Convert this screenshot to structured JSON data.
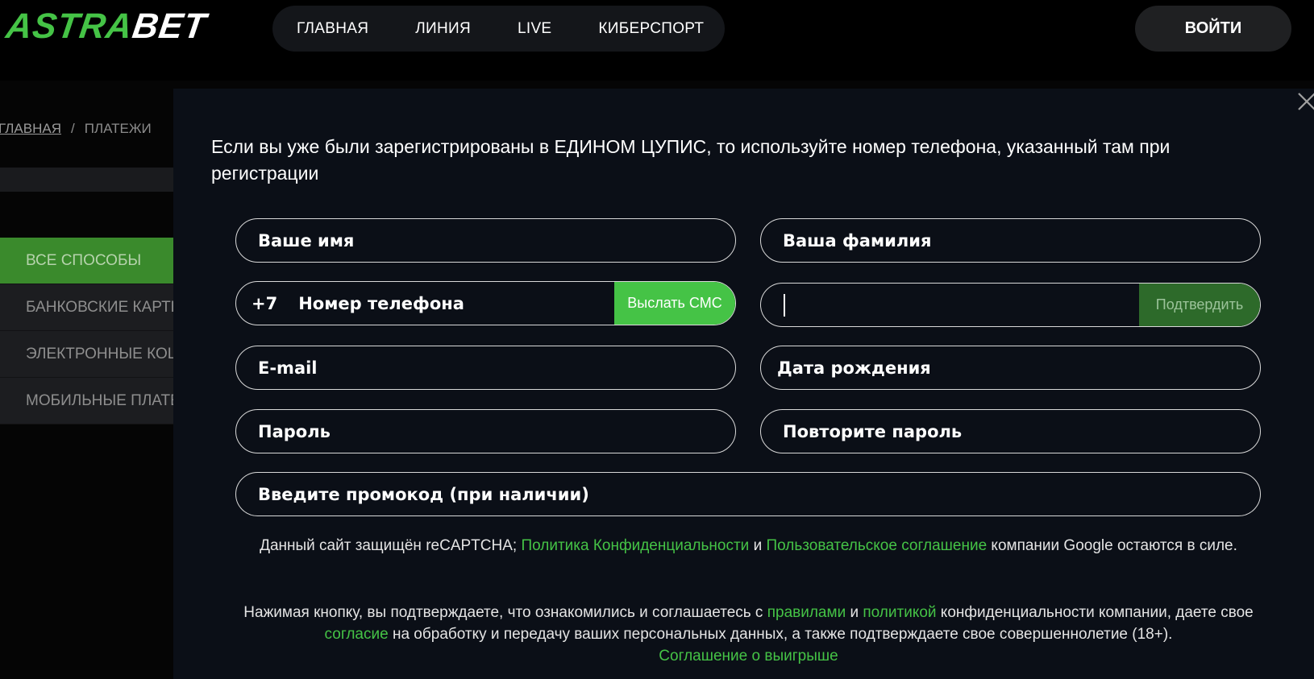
{
  "header": {
    "logo_part1": "ASTRA",
    "logo_part2": "BET",
    "nav": [
      "ГЛАВНАЯ",
      "ЛИНИЯ",
      "LIVE",
      "КИБЕРСПОРТ"
    ],
    "login_label": "ВОЙТИ"
  },
  "breadcrumb": {
    "home": "ГЛАВНАЯ",
    "separator": "/",
    "current": "ПЛАТЕЖИ"
  },
  "sidebar": {
    "items": [
      {
        "label": "ВСЕ СПОСОБЫ",
        "active": true
      },
      {
        "label": "БАНКОВСКИЕ КАРТЫ",
        "active": false
      },
      {
        "label": "ЭЛЕКТРОННЫЕ КОШЕЛЬКИ",
        "active": false
      },
      {
        "label": "МОБИЛЬНЫЕ ПЛАТЕЖИ",
        "active": false
      }
    ]
  },
  "modal": {
    "heading": "Если вы уже были зарегистрированы в ЕДИНОМ ЦУПИС, то используйте номер телефона, указанный там при регистрации",
    "fields": {
      "first_name": "Ваше имя",
      "last_name": "Ваша фамилия",
      "phone_prefix": "+7",
      "phone": "Номер телефона",
      "sms_button": "Выслать СМС",
      "code": "",
      "confirm_button": "Подтвердить",
      "email": "E-mail",
      "birth_date": "Дата рождения",
      "password": "Пароль",
      "repeat_password": "Повторите пароль",
      "promo": "Введите промокод (при наличии)"
    },
    "recaptcha": {
      "text1": "Данный сайт защищён reCAPTCHA; ",
      "link1": "Политика Конфиденциальности",
      "and1": " и ",
      "link2": "Пользовательское соглашение",
      "text2": " компании Google остаются в силе."
    },
    "consent": {
      "text1": "Нажимая кнопку, вы подтверждаете, что ознакомились и соглашаетесь с ",
      "link_rules": "правилами",
      "and": " и ",
      "link_policy": "политикой",
      "text2": " конфиденциальности компании, даете свое ",
      "link_consent": "согласие",
      "text3": " на обработку и передачу ваших персональных данных, а также подтверждаете свое совершеннолетие (18+).",
      "link_agreement": "Соглашение о выигрыше"
    }
  },
  "colors": {
    "accent": "#45c346",
    "background": "#000000",
    "modal": "#0b0f17"
  }
}
